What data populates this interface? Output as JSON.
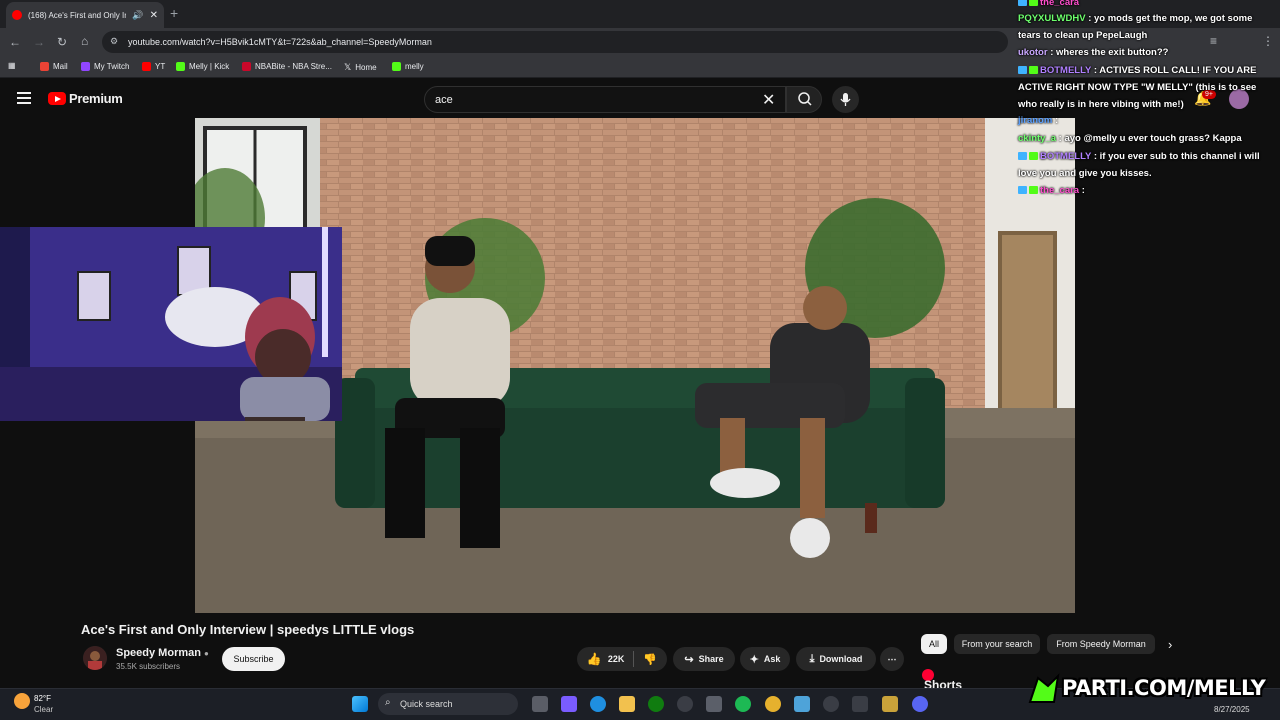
{
  "browser": {
    "tab_title": "(168) Ace's First and Only In",
    "url": "youtube.com/watch?v=H5Bvik1cMTY&t=722s&ab_channel=SpeedyMorman",
    "bookmarks": [
      {
        "label": "Mail",
        "color": "#ea4335"
      },
      {
        "label": "My Twitch",
        "color": "#9146ff"
      },
      {
        "label": "YT",
        "color": "#ff0000"
      },
      {
        "label": "Melly | Kick",
        "color": "#53fc18"
      },
      {
        "label": "NBABite - NBA Stre...",
        "color": "#c9082a"
      },
      {
        "label": "Home",
        "color": "#ffffff"
      },
      {
        "label": "melly",
        "color": "#53fc18"
      }
    ]
  },
  "youtube": {
    "brand": "Premium",
    "search_query": "ace",
    "notification_count": "9+",
    "video_title": "Ace's First and Only Interview | speedys LITTLE vlogs",
    "channel_name": "Speedy Morman",
    "subscribers": "35.5K subscribers",
    "subscribe_label": "Subscribe",
    "likes": "22K",
    "share_label": "Share",
    "ask_label": "Ask",
    "download_label": "Download",
    "chips": [
      "All",
      "From your search",
      "From Speedy Morman"
    ],
    "shorts_label": "Shorts"
  },
  "chat": [
    {
      "user": "the_cara",
      "text": "",
      "color": "#ff4ecd"
    },
    {
      "user": "PQYXULWDHV",
      "text": " : yo mods get the mop, we got some tears to clean up PepeLaugh",
      "color": "#6dff6d"
    },
    {
      "user": "ukotor",
      "text": " : wheres the exit button??",
      "color": "#c9a7ff"
    },
    {
      "user": "BOTMELLY",
      "text": " : ACTIVES ROLL CALL! IF YOU ARE ACTIVE RIGHT NOW TYPE \"W MELLY\" (this is to see who really is in here vibing with me!)",
      "color": "#b080ff"
    },
    {
      "user": "jiranom",
      "text": " : ",
      "color": "#5aa0ff"
    },
    {
      "user": "ckinty_a",
      "text": " : ayo @melly u ever touch grass? Kappa",
      "color": "#6dff6d"
    },
    {
      "user": "BOTMELLY",
      "text": " : if you ever sub to this channel i will love you and give you kisses.",
      "color": "#b080ff"
    },
    {
      "user": "the_cara",
      "text": " : ",
      "color": "#ff4ecd"
    }
  ],
  "taskbar": {
    "temp": "82°F",
    "condition": "Clear",
    "search_placeholder": "Quick search",
    "date": "8/27/2025"
  },
  "overlay": {
    "brand_text": "PARTI.COM/MELLY"
  }
}
